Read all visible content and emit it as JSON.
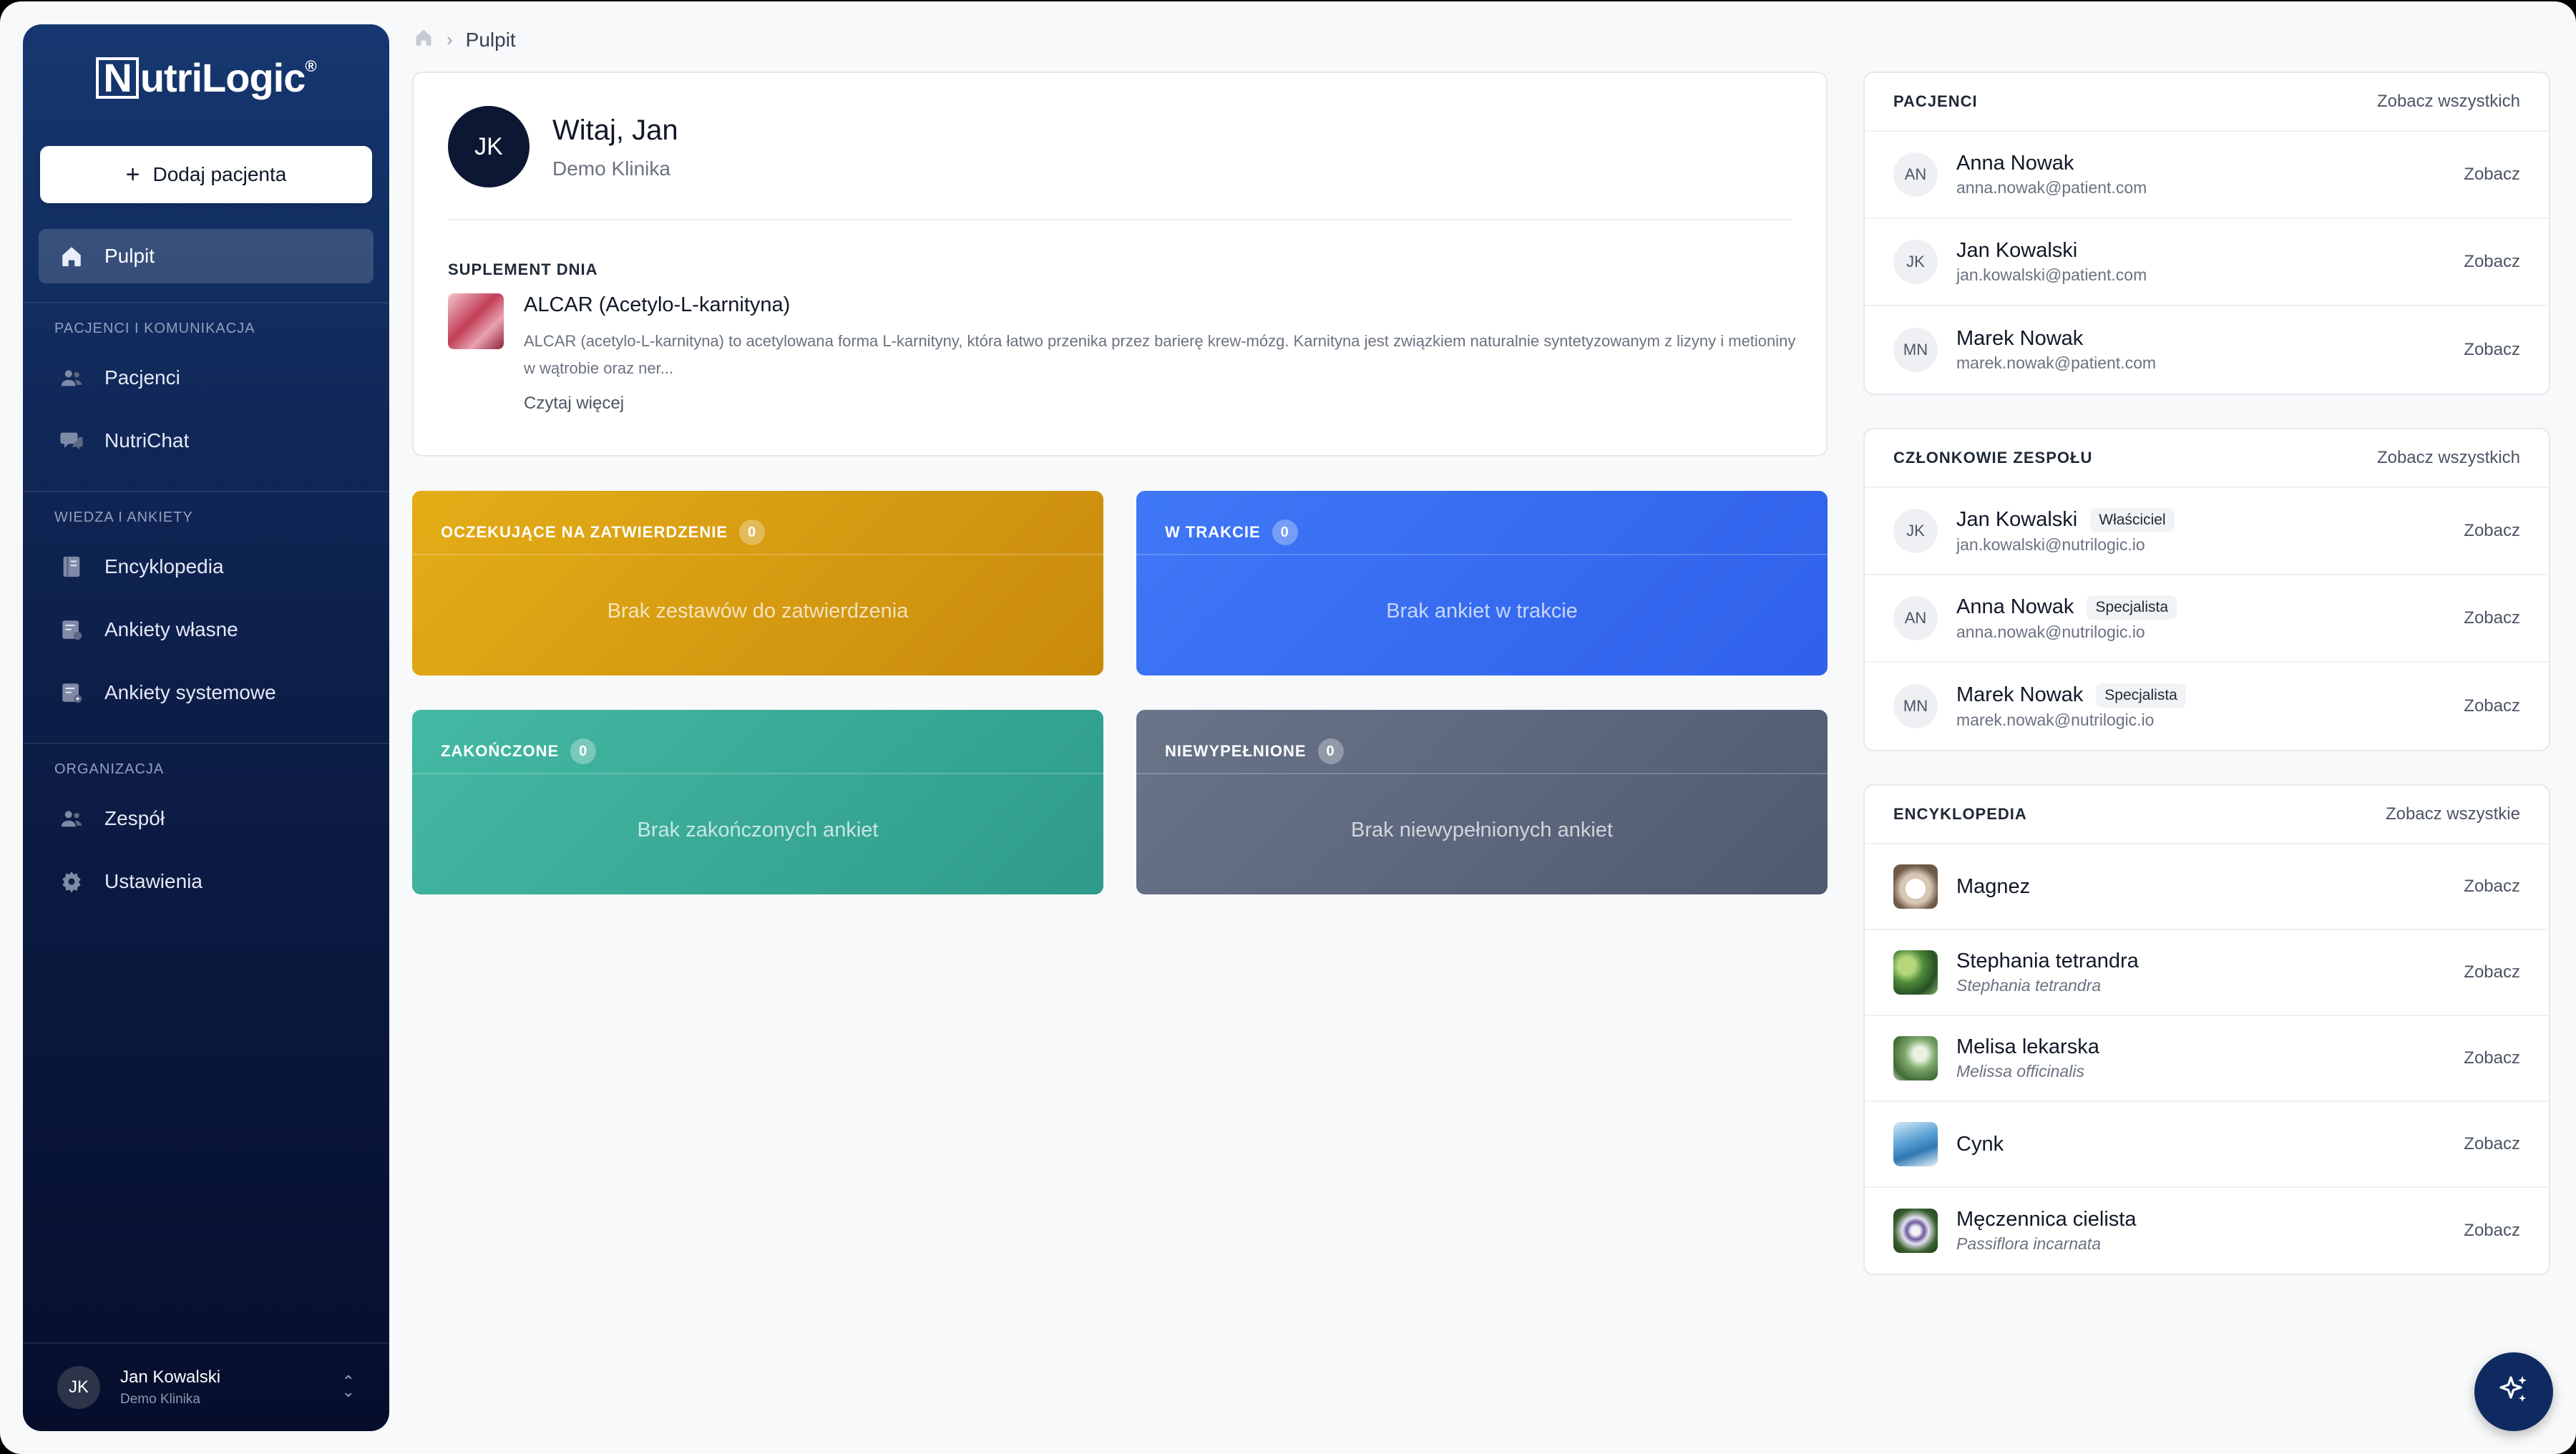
{
  "brand": {
    "name": "NutriLogic",
    "first_letter": "N",
    "rest": "utriLogic",
    "registered": "®"
  },
  "sidebar": {
    "add_patient": "Dodaj pacjenta",
    "sections": {
      "main": {
        "items": [
          {
            "label": "Pulpit",
            "icon": "home-icon",
            "active": true
          }
        ]
      },
      "patients": {
        "title": "PACJENCI I KOMUNIKACJA",
        "items": [
          {
            "label": "Pacjenci",
            "icon": "users-icon"
          },
          {
            "label": "NutriChat",
            "icon": "chat-icon"
          }
        ]
      },
      "knowledge": {
        "title": "WIEDZA I ANKIETY",
        "items": [
          {
            "label": "Encyklopedia",
            "icon": "book-icon"
          },
          {
            "label": "Ankiety własne",
            "icon": "survey-icon"
          },
          {
            "label": "Ankiety systemowe",
            "icon": "survey-system-icon"
          }
        ]
      },
      "org": {
        "title": "ORGANIZACJA",
        "items": [
          {
            "label": "Zespół",
            "icon": "team-icon"
          },
          {
            "label": "Ustawienia",
            "icon": "gear-icon"
          }
        ]
      }
    },
    "user": {
      "initials": "JK",
      "name": "Jan Kowalski",
      "clinic": "Demo Klinika"
    }
  },
  "breadcrumb": {
    "current": "Pulpit"
  },
  "welcome": {
    "initials": "JK",
    "greeting": "Witaj, Jan",
    "clinic": "Demo Klinika",
    "supplement_header": "SUPLEMENT DNIA",
    "supplement_title": "ALCAR (Acetylo-L-karnityna)",
    "supplement_desc": "ALCAR (acetylo-L-karnityna) to acetylowana forma L-karnityny, która łatwo przenika przez barierę krew-mózg. Karnityna jest związkiem naturalnie syntetyzowanym z lizyny i metioniny w wątrobie oraz ner...",
    "read_more": "Czytaj więcej"
  },
  "stats": [
    {
      "title": "OCZEKUJĄCE NA ZATWIERDZENIE",
      "count": "0",
      "empty": "Brak zestawów do zatwierdzenia",
      "color": "#d99e12"
    },
    {
      "title": "W TRAKCIE",
      "count": "0",
      "empty": "Brak ankiet w trakcie",
      "color": "#3a6ff3"
    },
    {
      "title": "ZAKOŃCZONE",
      "count": "0",
      "empty": "Brak zakończonych ankiet",
      "color": "#3aad98"
    },
    {
      "title": "NIEWYPEŁNIONE",
      "count": "0",
      "empty": "Brak niewypełnionych ankiet",
      "color": "#5d667c"
    }
  ],
  "patients": {
    "title": "PACJENCI",
    "see_all": "Zobacz wszystkich",
    "view": "Zobacz",
    "items": [
      {
        "initials": "AN",
        "name": "Anna Nowak",
        "email": "anna.nowak@patient.com"
      },
      {
        "initials": "JK",
        "name": "Jan Kowalski",
        "email": "jan.kowalski@patient.com"
      },
      {
        "initials": "MN",
        "name": "Marek Nowak",
        "email": "marek.nowak@patient.com"
      }
    ]
  },
  "team": {
    "title": "CZŁONKOWIE ZESPOŁU",
    "see_all": "Zobacz wszystkich",
    "view": "Zobacz",
    "items": [
      {
        "initials": "JK",
        "name": "Jan Kowalski",
        "role": "Właściciel",
        "email": "jan.kowalski@nutrilogic.io"
      },
      {
        "initials": "AN",
        "name": "Anna Nowak",
        "role": "Specjalista",
        "email": "anna.nowak@nutrilogic.io"
      },
      {
        "initials": "MN",
        "name": "Marek Nowak",
        "role": "Specjalista",
        "email": "marek.nowak@nutrilogic.io"
      }
    ]
  },
  "encyclopedia": {
    "title": "ENCYKLOPEDIA",
    "see_all": "Zobacz wszystkie",
    "view": "Zobacz",
    "items": [
      {
        "name": "Magnez",
        "latin": ""
      },
      {
        "name": "Stephania tetrandra",
        "latin": "Stephania tetrandra"
      },
      {
        "name": "Melisa lekarska",
        "latin": "Melissa officinalis"
      },
      {
        "name": "Cynk",
        "latin": ""
      },
      {
        "name": "Męczennica cielista",
        "latin": "Passiflora incarnata"
      }
    ]
  },
  "fab": {
    "icon": "sparkles-icon"
  }
}
